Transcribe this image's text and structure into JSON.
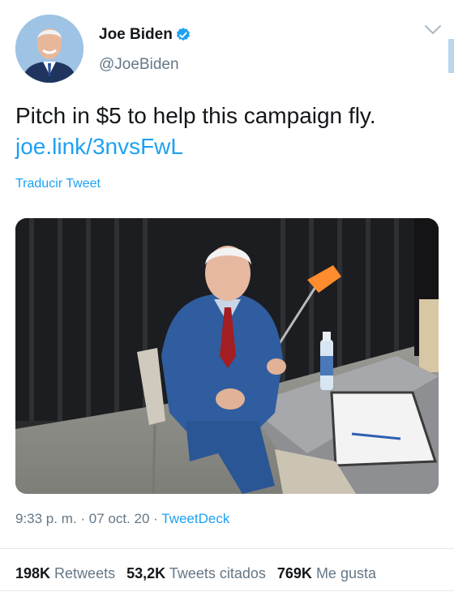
{
  "author": {
    "name": "Joe Biden",
    "handle": "@JoeBiden",
    "verified": true,
    "avatar_icon": "profile-photo"
  },
  "tweet": {
    "text": "Pitch in $5 to help this campaign fly.",
    "link": "joe.link/3nvsFwL",
    "translate_label": "Traducir Tweet",
    "media_description": "photo"
  },
  "meta": {
    "time": "9:33 p. m.",
    "separator": "·",
    "date": "07 oct. 20",
    "source": "TweetDeck"
  },
  "stats": {
    "retweets_count": "198K",
    "retweets_label": "Retweets",
    "quotes_count": "53,2K",
    "quotes_label": "Tweets citados",
    "likes_count": "769K",
    "likes_label": "Me gusta"
  },
  "colors": {
    "accent": "#1da1f2",
    "text": "#14171a",
    "secondary": "#657786"
  }
}
